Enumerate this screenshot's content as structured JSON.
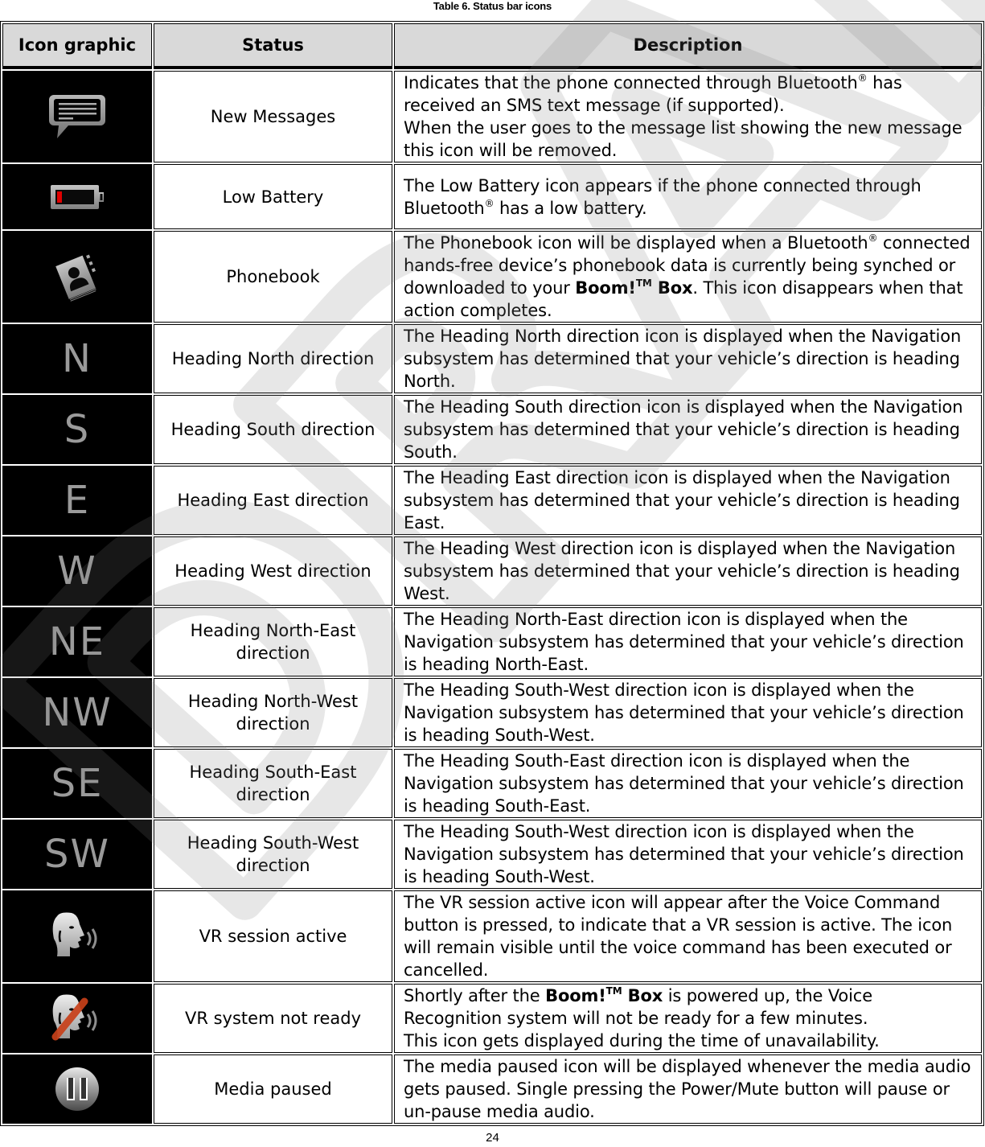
{
  "caption": "Table 6. Status bar icons",
  "headers": {
    "icon": "Icon graphic",
    "status": "Status",
    "description": "Description"
  },
  "trademark": {
    "registered": "®",
    "tm": "TM",
    "brand": "Boom!",
    "brand_suffix": "Box"
  },
  "rows": [
    {
      "icon": "message-bubble-icon",
      "status": "New Messages",
      "description": {
        "p1": "Indicates that the phone connected through Bluetooth",
        "p2": " has received an SMS text message (if supported).",
        "p3": "When the user goes to the message list showing the new message this icon will be removed."
      }
    },
    {
      "icon": "low-battery-icon",
      "status": "Low Battery",
      "description": {
        "p1": "The Low Battery icon appears if the phone connected through Bluetooth",
        "p2": " has a low battery."
      }
    },
    {
      "icon": "phonebook-icon",
      "status": "Phonebook",
      "description": {
        "p1": "The Phonebook icon will be displayed when a Bluetooth",
        "p2": " connected hands-free device’s phonebook data is currently being synched or downloaded to your ",
        "p3": ".  This icon disappears when that action completes."
      }
    },
    {
      "icon": "N",
      "status": "Heading North direction",
      "description": "The Heading North direction icon is displayed when the Navigation subsystem has determined that your vehicle’s direction is heading North."
    },
    {
      "icon": "S",
      "status": "Heading South direction",
      "description": "The Heading South direction icon is displayed when the Navigation subsystem has determined that your vehicle’s direction is heading South."
    },
    {
      "icon": "E",
      "status": "Heading East direction",
      "description": "The Heading East direction icon is displayed when the Navigation subsystem has determined that your vehicle’s direction is heading East."
    },
    {
      "icon": "W",
      "status": "Heading West direction",
      "description": "The Heading West direction icon is displayed when the Navigation subsystem has determined that your vehicle’s direction is heading West."
    },
    {
      "icon": "NE",
      "status": "Heading North-East direction",
      "description": "The Heading North-East direction icon is displayed when the Navigation subsystem has determined that your vehicle’s direction is heading North-East."
    },
    {
      "icon": "NW",
      "status": "Heading North-West direction",
      "description": "The Heading South-West direction icon is displayed when the Navigation subsystem has determined that your vehicle’s direction is heading South-West."
    },
    {
      "icon": "SE",
      "status": "Heading South-East direction",
      "description": "The Heading South-East direction icon is displayed when the Navigation subsystem has determined that your vehicle’s direction is heading South-East."
    },
    {
      "icon": "SW",
      "status": "Heading South-West direction",
      "description": "The Heading South-West direction icon is displayed when the Navigation subsystem has determined that your vehicle’s direction is heading South-West."
    },
    {
      "icon": "vr-session-active-icon",
      "status": "VR session active",
      "description": "The VR session active icon will appear after the Voice Command button is pressed, to indicate that a VR session is active. The icon will remain visible until the voice command has been executed or cancelled."
    },
    {
      "icon": "vr-not-ready-icon",
      "status": "VR system not ready",
      "description": {
        "p1": "Shortly after the ",
        "p2": " is powered up, the Voice Recognition system will not be ready for a few minutes.",
        "p3": "This icon gets displayed during the time of unavailability."
      }
    },
    {
      "icon": "media-paused-icon",
      "status": "Media paused",
      "description": "The media paused icon will be displayed whenever the media audio gets paused. Single pressing the Power/Mute button will pause or un-pause media audio."
    }
  ],
  "watermark": "DRAFT",
  "page_number": "24",
  "colors": {
    "header_bg": "#d9d9d9",
    "icon_bg": "#000000",
    "icon_gray": "#9a9a9a",
    "battery_red": "#e00000",
    "vr_slash": "#c8401a",
    "watermark": "#9e9e9e"
  }
}
